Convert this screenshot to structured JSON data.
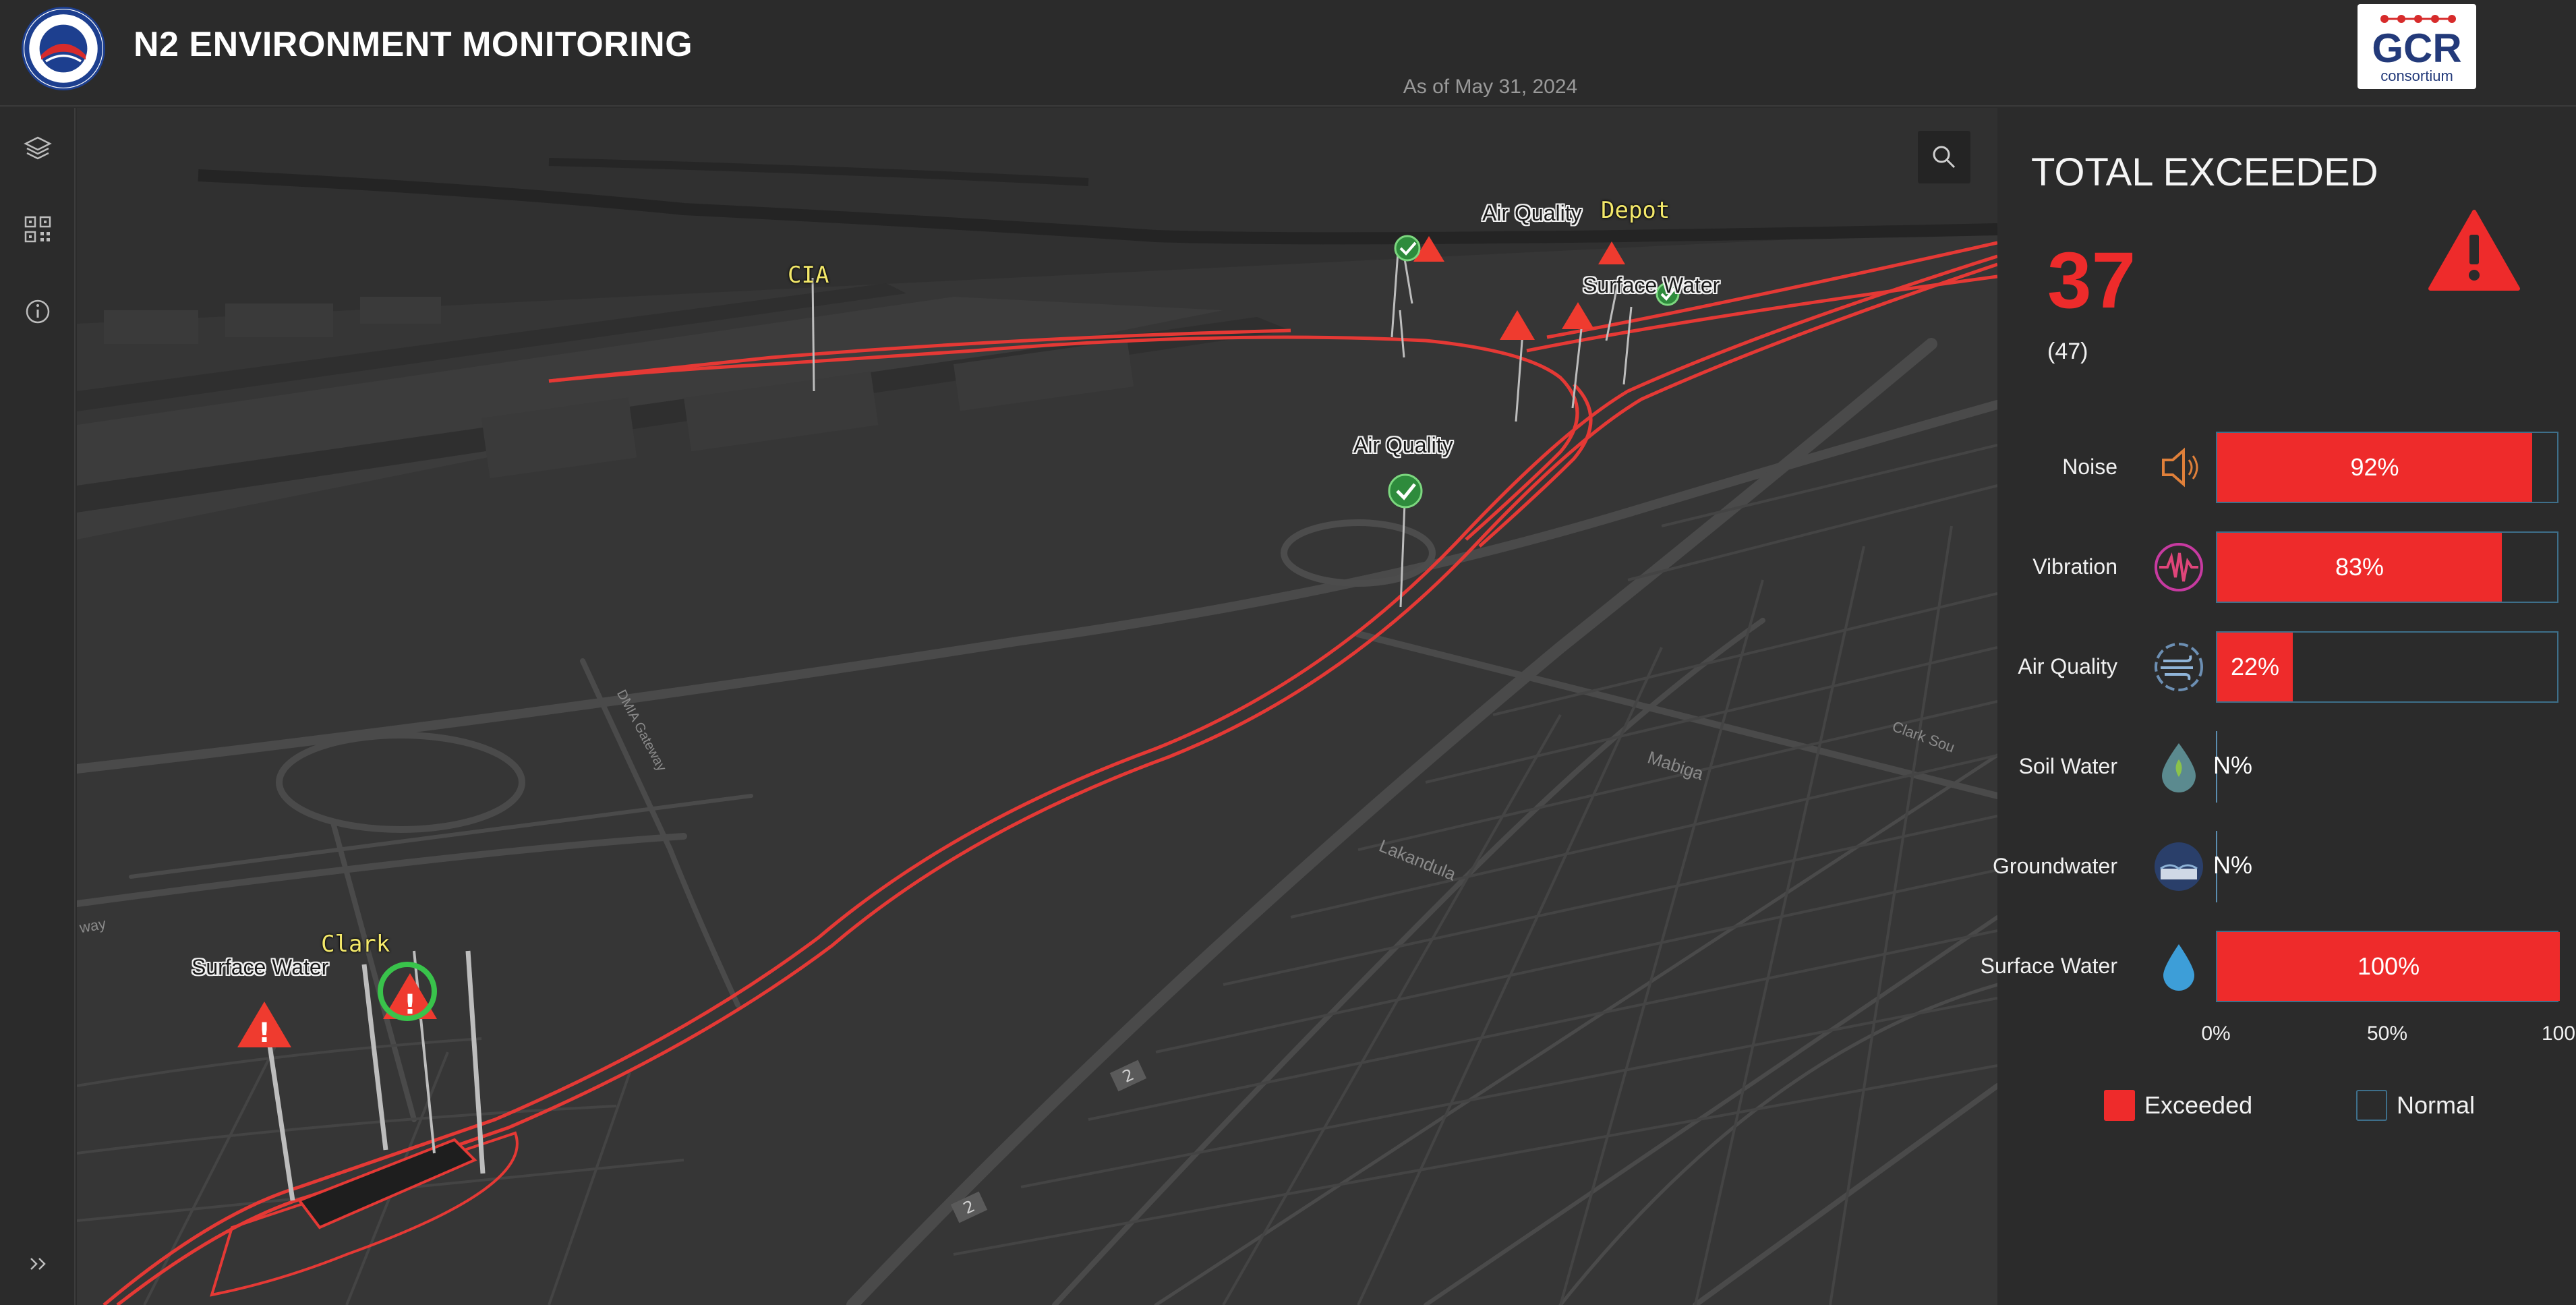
{
  "header": {
    "title": "N2 ENVIRONMENT MONITORING",
    "as_of": "As of May 31, 2024",
    "right_logo_text": "GCR",
    "right_logo_sub": "consortium"
  },
  "toolbar": {
    "icons": [
      "layers-icon",
      "qr-code-icon",
      "info-icon",
      "expand-icon"
    ]
  },
  "map": {
    "labels": {
      "cia": "CIA",
      "depot": "Depot",
      "clark": "Clark",
      "air_quality_top": "Air Quality",
      "surface_water_top": "Surface Water",
      "air_quality_mid": "Air Quality",
      "surface_water_bottom": "Surface Water"
    },
    "road_names": {
      "mabiga": "Mabiga",
      "lakandula": "Lakandula",
      "dmia_gateway": "DMIA Gateway",
      "clark_south": "Clark Sou",
      "way": "way"
    },
    "route_markers": [
      "2",
      "2"
    ]
  },
  "summary": {
    "title": "TOTAL EXCEEDED",
    "total_exceeded": "37",
    "total_count": "(47)"
  },
  "chart_data": {
    "type": "bar",
    "orientation": "horizontal",
    "categories": [
      "Noise",
      "Vibration",
      "Air Quality",
      "Soil Water",
      "Groundwater",
      "Surface Water"
    ],
    "series": [
      {
        "name": "Exceeded",
        "values": [
          92,
          83,
          22,
          null,
          null,
          100
        ],
        "labels": [
          "92%",
          "83%",
          "22%",
          "N%",
          "N%",
          "100%"
        ]
      }
    ],
    "xlim": [
      0,
      100
    ],
    "x_ticks": [
      "0%",
      "50%",
      "100"
    ],
    "legend": [
      "Exceeded",
      "Normal"
    ],
    "legend_position": "bottom",
    "colors": {
      "exceeded": "#ee2b2b",
      "normal_border": "#3e6f8a"
    }
  },
  "legend": {
    "exceeded_label": "Exceeded",
    "normal_label": "Normal"
  }
}
